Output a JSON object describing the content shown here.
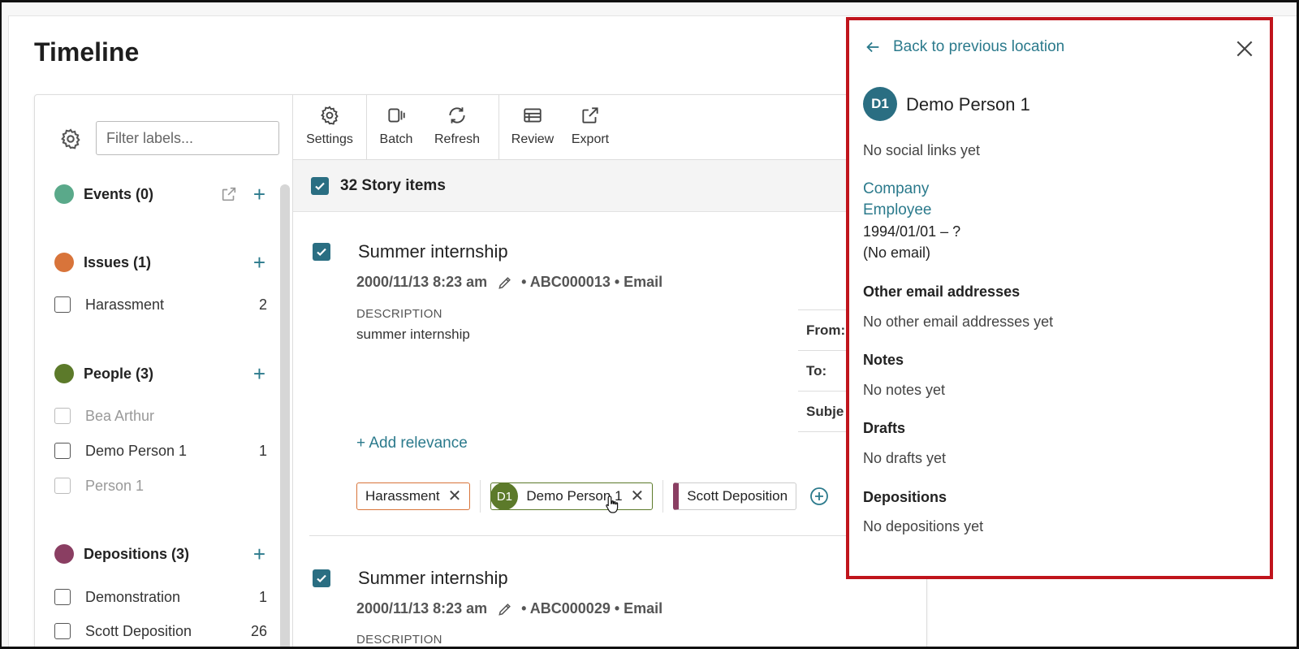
{
  "page": {
    "title": "Timeline"
  },
  "sidebar": {
    "filter_placeholder": "Filter labels...",
    "sections": {
      "events": {
        "label": "Events (0)",
        "color": "#5aa98a"
      },
      "issues": {
        "label": "Issues (1)",
        "color": "#d8743a",
        "items": [
          {
            "label": "Harassment",
            "count": "2"
          }
        ]
      },
      "people": {
        "label": "People (3)",
        "color": "#5c7a2a",
        "items": [
          {
            "label": "Bea Arthur",
            "count": ""
          },
          {
            "label": "Demo Person 1",
            "count": "1"
          },
          {
            "label": "Person 1",
            "count": ""
          }
        ]
      },
      "depositions": {
        "label": "Depositions (3)",
        "color": "#8a3e62",
        "items": [
          {
            "label": "Demonstration",
            "count": "1"
          },
          {
            "label": "Scott Deposition",
            "count": "26"
          }
        ]
      }
    }
  },
  "toolbar": {
    "settings": "Settings",
    "batch": "Batch",
    "refresh": "Refresh",
    "review": "Review",
    "export": "Export"
  },
  "story": {
    "count_label": "32 Story items"
  },
  "items": [
    {
      "title": "Summer internship",
      "date": "2000/11/13 8:23 am",
      "meta": "• ABC000013 • Email",
      "desc_label": "DESCRIPTION",
      "desc": "summer internship",
      "fields": {
        "from": "From:",
        "to": "To:",
        "subject": "Subje"
      },
      "add_relevance": "+ Add relevance",
      "chips": {
        "issue": "Harassment",
        "person_initials": "D1",
        "person": "Demo Person 1",
        "deposition": "Scott Deposition"
      }
    },
    {
      "title": "Summer internship",
      "date": "2000/11/13 8:23 am",
      "meta": "• ABC000029 • Email",
      "desc_label": "DESCRIPTION"
    }
  ],
  "panel": {
    "back_label": "Back to previous location",
    "initials": "D1",
    "name": "Demo Person 1",
    "social": "No social links yet",
    "company_label": "Company",
    "role": "Employee",
    "dates": "1994/01/01 – ?",
    "email": "(No email)",
    "other_email_head": "Other email addresses",
    "other_email_text": "No other email addresses yet",
    "notes_head": "Notes",
    "notes_text": "No notes yet",
    "drafts_head": "Drafts",
    "drafts_text": "No drafts yet",
    "depositions_head": "Depositions",
    "depositions_text": "No depositions yet"
  }
}
